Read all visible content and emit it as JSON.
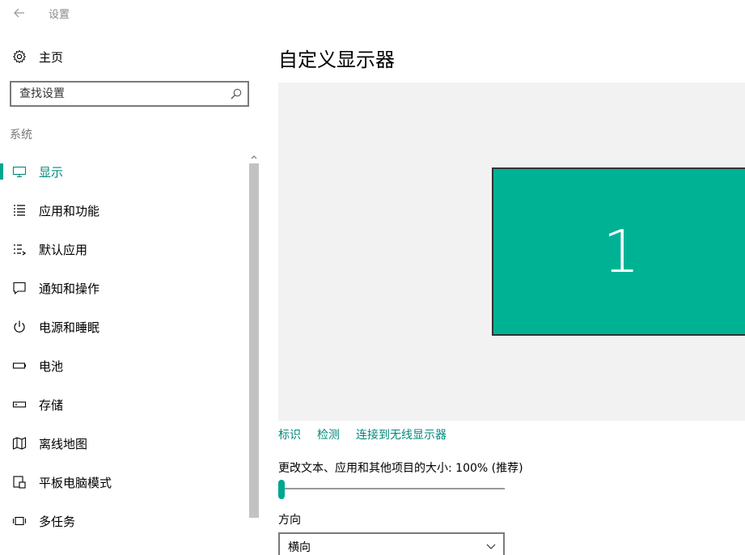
{
  "window": {
    "title": "设置"
  },
  "sidebar": {
    "home_label": "主页",
    "search": {
      "placeholder": "查找设置",
      "value": ""
    },
    "section_label": "系统",
    "items": [
      {
        "label": "显示",
        "icon": "monitor-icon",
        "active": true
      },
      {
        "label": "应用和功能",
        "icon": "app-list-icon",
        "active": false
      },
      {
        "label": "默认应用",
        "icon": "default-apps-icon",
        "active": false
      },
      {
        "label": "通知和操作",
        "icon": "notification-icon",
        "active": false
      },
      {
        "label": "电源和睡眠",
        "icon": "power-icon",
        "active": false
      },
      {
        "label": "电池",
        "icon": "battery-icon",
        "active": false
      },
      {
        "label": "存储",
        "icon": "storage-icon",
        "active": false
      },
      {
        "label": "离线地图",
        "icon": "map-icon",
        "active": false
      },
      {
        "label": "平板电脑模式",
        "icon": "tablet-mode-icon",
        "active": false
      },
      {
        "label": "多任务",
        "icon": "multitask-icon",
        "active": false
      }
    ]
  },
  "main": {
    "title": "自定义显示器",
    "monitor_number": "1",
    "links": {
      "identify": "标识",
      "detect": "检测",
      "wireless": "连接到无线显示器"
    },
    "scale": {
      "label": "更改文本、应用和其他项目的大小: 100% (推荐)",
      "value_fraction": 0
    },
    "orientation": {
      "label": "方向",
      "selected": "横向"
    }
  },
  "colors": {
    "accent": "#00a78e",
    "accent_text": "#00897b",
    "monitor_fill": "#00b294",
    "display_bg": "#f2f2f2"
  }
}
